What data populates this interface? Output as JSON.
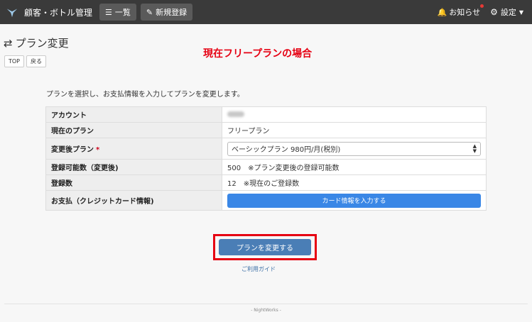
{
  "navbar": {
    "brand": "顧客・ボトル管理",
    "list_label": "一覧",
    "new_label": "新規登録",
    "notify_label": "お知らせ",
    "settings_label": "設定"
  },
  "page": {
    "title": "プラン変更",
    "top_button": "TOP",
    "back_button": "戻る"
  },
  "annotation": "現在フリープランの場合",
  "intro": "プランを選択し、お支払情報を入力してプランを変更します。",
  "table": {
    "rows": [
      {
        "label": "アカウント",
        "value": ""
      },
      {
        "label": "現在のプラン",
        "value": "フリープラン"
      },
      {
        "label": "変更後プラン",
        "required": "*",
        "value": "ベーシックプラン 980円/月(税別)"
      },
      {
        "label": "登録可能数（変更後)",
        "value": "500",
        "note": "※プラン変更後の登録可能数"
      },
      {
        "label": "登録数",
        "value": "12",
        "note": "※現在のご登録数"
      },
      {
        "label": "お支払（クレジットカード情報)",
        "button": "カード情報を入力する"
      }
    ]
  },
  "submit_label": "プランを変更する",
  "guide_link": "ご利用ガイド",
  "footer": "- NightWorks -",
  "colors": {
    "navbar": "#3a3a3a",
    "primary": "#3a87e6",
    "submit": "#4a7eb6",
    "highlight": "#e60012"
  }
}
